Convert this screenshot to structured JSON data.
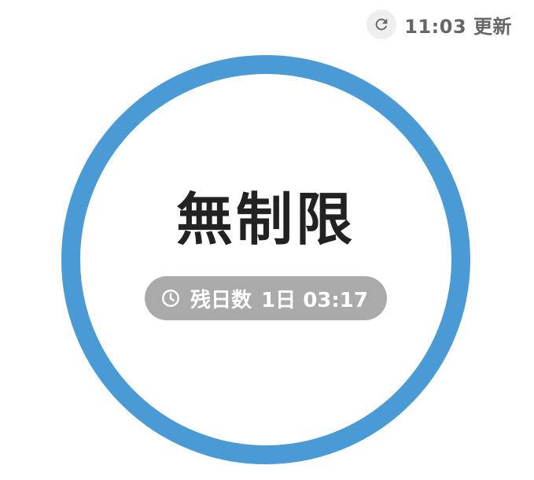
{
  "header": {
    "refresh_icon": "refresh-icon",
    "updated_time": "11:03 更新"
  },
  "gauge": {
    "value_text": "無制限",
    "ring_color": "#4a9bd5",
    "fill_fraction": 1.0,
    "remaining": {
      "icon": "clock-icon",
      "label": "残日数",
      "value": "1日 03:17"
    }
  },
  "colors": {
    "pill_background": "#aaaaaa",
    "text_dark": "#222222",
    "text_muted": "#666666"
  }
}
